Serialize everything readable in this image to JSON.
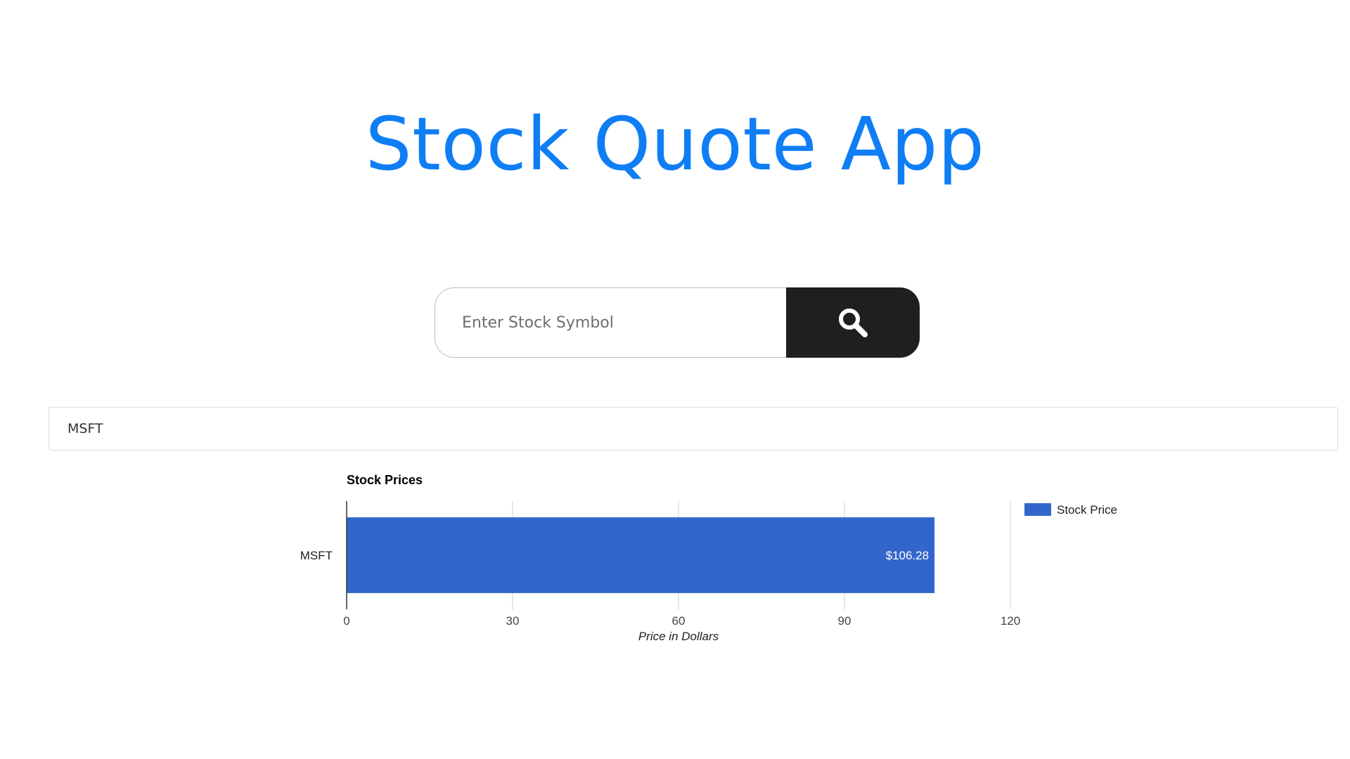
{
  "app": {
    "title": "Stock Quote App"
  },
  "search": {
    "placeholder": "Enter Stock Symbol",
    "value": "",
    "button_icon": "search-icon",
    "button_color": "#1f1f1f"
  },
  "result": {
    "symbol": "MSFT"
  },
  "colors": {
    "title": "#0f7ef5",
    "bar": "#3366cc"
  },
  "chart_data": {
    "type": "bar",
    "orientation": "horizontal",
    "title": "Stock Prices",
    "xlabel": "Price in Dollars",
    "ylabel": "",
    "categories": [
      "MSFT"
    ],
    "series": [
      {
        "name": "Stock Price",
        "values": [
          106.28
        ],
        "data_labels": [
          "$106.28"
        ],
        "color": "#3366cc"
      }
    ],
    "xlim": [
      0,
      120
    ],
    "xticks": [
      0,
      30,
      60,
      90,
      120
    ],
    "xtick_labels": [
      "0",
      "30",
      "60",
      "90",
      "120"
    ],
    "grid": true,
    "legend": "right"
  }
}
